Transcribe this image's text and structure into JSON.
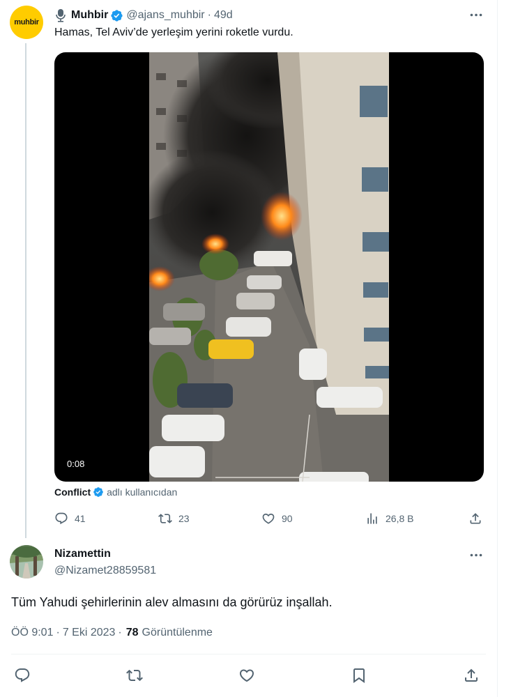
{
  "tweet": {
    "author_name": "Muhbir",
    "avatar_text": "muhbir",
    "handle": "@ajans_muhbir",
    "separator": "·",
    "time_ago": "49d",
    "text": "Hamas, Tel Aviv’de yerleşim yerini roketle vurdu.",
    "video_duration": "0:08",
    "attribution_source": "Conflict",
    "attribution_suffix": "adlı kullanıcıdan",
    "stats": {
      "replies": "41",
      "reposts": "23",
      "likes": "90",
      "views": "26,8 B"
    }
  },
  "reply": {
    "author_name": "Nizamettin",
    "handle": "@Nizamet28859581",
    "text": "Tüm Yahudi şehirlerinin alev almasını da görürüz inşallah.",
    "time": "ÖÖ 9:01",
    "separator": "·",
    "date": "7 Eki 2023",
    "views_count": "78",
    "views_label": "Görüntülenme"
  },
  "colors": {
    "verified_blue": "#1d9bf0",
    "muted_text": "#536471",
    "brand_yellow": "#ffcc00"
  },
  "icons": {
    "tweet_header": [
      "microphone-icon",
      "verified-badge-icon",
      "more-icon"
    ],
    "tweet_actions": [
      "reply-icon",
      "repost-icon",
      "like-icon",
      "views-icon",
      "share-icon"
    ],
    "reply_actions": [
      "reply-icon",
      "repost-icon",
      "like-icon",
      "bookmark-icon",
      "share-icon"
    ]
  }
}
